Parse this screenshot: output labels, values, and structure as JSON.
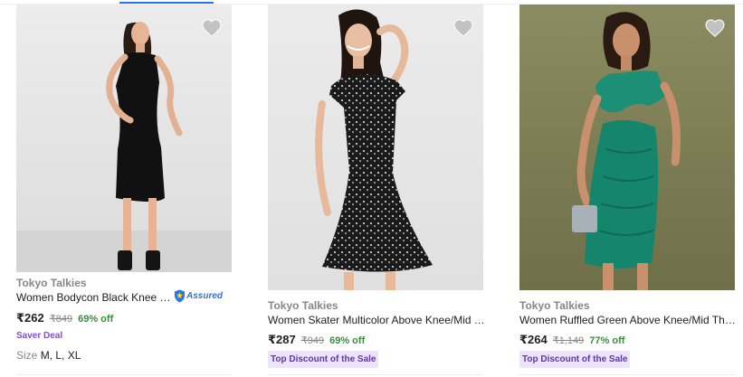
{
  "colors": {
    "price_text": "#212121",
    "muted_text": "#878787",
    "discount_green": "#388e3c",
    "assured_blue": "#2874f0",
    "saver_purple": "#8a47e6",
    "badge_text": "#5e35b1",
    "badge_bg": "#ede4fb",
    "wishlist_grey": "#c2c2c2"
  },
  "products": [
    {
      "image_icon": "product-photo-black-bodycon-dress",
      "wishlist_icon": "heart-icon",
      "brand": "Tokyo Talkies",
      "title": "Women Bodycon Black Knee Le...",
      "assured": {
        "icon": "assured-shield-icon",
        "label": "Assured"
      },
      "price": "₹262",
      "mrp": "₹849",
      "discount": "69% off",
      "deal": "Saver Deal",
      "size_label": "Size",
      "sizes": "M, L, XL"
    },
    {
      "image_icon": "product-photo-black-floral-skater-dress",
      "wishlist_icon": "heart-icon",
      "brand": "Tokyo Talkies",
      "title": "Women Skater Multicolor Above Knee/Mid Th...",
      "price": "₹287",
      "mrp": "₹949",
      "discount": "69% off",
      "badge": "Top Discount of the Sale"
    },
    {
      "image_icon": "product-photo-green-ruffled-dress",
      "wishlist_icon": "heart-icon",
      "brand": "Tokyo Talkies",
      "title": "Women Ruffled Green Above Knee/Mid Thigh...",
      "price": "₹264",
      "mrp": "₹1,149",
      "discount": "77% off",
      "badge": "Top Discount of the Sale"
    }
  ]
}
